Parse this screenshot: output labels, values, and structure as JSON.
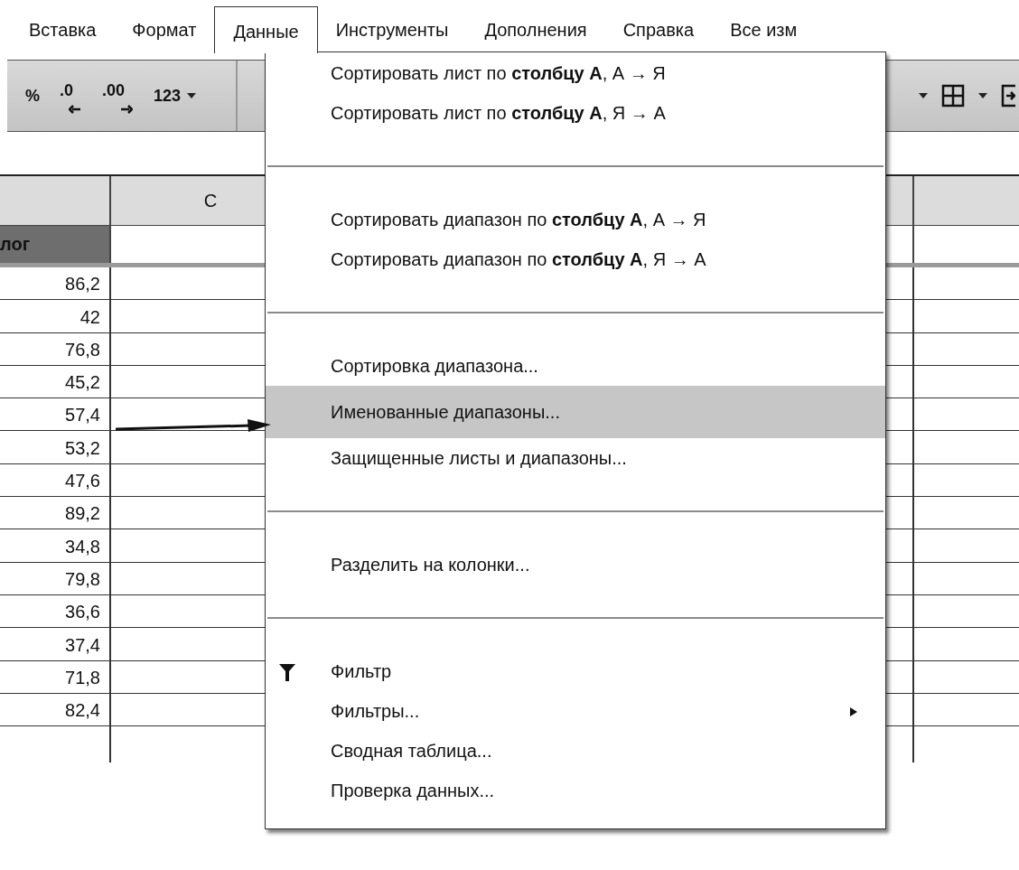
{
  "menu_bar": [
    {
      "label": "Вставка",
      "selected": false
    },
    {
      "label": "Формат",
      "selected": false
    },
    {
      "label": "Данные",
      "selected": true
    },
    {
      "label": "Инструменты",
      "selected": false
    },
    {
      "label": "Дополнения",
      "selected": false
    },
    {
      "label": "Справка",
      "selected": false
    },
    {
      "label": "Все изм",
      "selected": false
    }
  ],
  "toolbar": {
    "percent": "%",
    "decrease_decimals": ".0",
    "increase_decimals": ".00",
    "number_format": "123"
  },
  "sheet": {
    "header_cell": "C",
    "total_label": "лог",
    "values": [
      "86,2",
      "42",
      "76,8",
      "45,2",
      "57,4",
      "53,2",
      "47,6",
      "89,2",
      "34,8",
      "79,8",
      "36,6",
      "37,4",
      "71,8",
      "82,4"
    ]
  },
  "dropdown_menu": [
    {
      "kind": "item",
      "label": "Сортировать лист по **столбцу А**, А → Я",
      "selected": false
    },
    {
      "kind": "item",
      "label": "Сортировать лист по **столбцу А**, Я → А",
      "selected": false
    },
    {
      "kind": "separator"
    },
    {
      "kind": "item",
      "label": "Сортировать диапазон по **столбцу А**, А → Я",
      "selected": false
    },
    {
      "kind": "item",
      "label": "Сортировать диапазон по **столбцу А**, Я → А",
      "selected": false
    },
    {
      "kind": "separator"
    },
    {
      "kind": "item",
      "label": "Сортировка диапазона...",
      "selected": false
    },
    {
      "kind": "item",
      "label": "Именованные диапазоны...",
      "selected": true
    },
    {
      "kind": "item",
      "label": "Защищенные листы и диапазоны...",
      "selected": false
    },
    {
      "kind": "separator"
    },
    {
      "kind": "item",
      "label": "Разделить на колонки...",
      "selected": false
    },
    {
      "kind": "separator"
    },
    {
      "kind": "filter",
      "label": "Фильтр",
      "selected": false
    },
    {
      "kind": "submenu",
      "label": "Фильтры...",
      "selected": false
    },
    {
      "kind": "item",
      "label": "Сводная таблица...",
      "selected": false
    },
    {
      "kind": "item",
      "label": "Проверка данных...",
      "selected": false
    }
  ],
  "annotation": {
    "kind": "arrow"
  }
}
